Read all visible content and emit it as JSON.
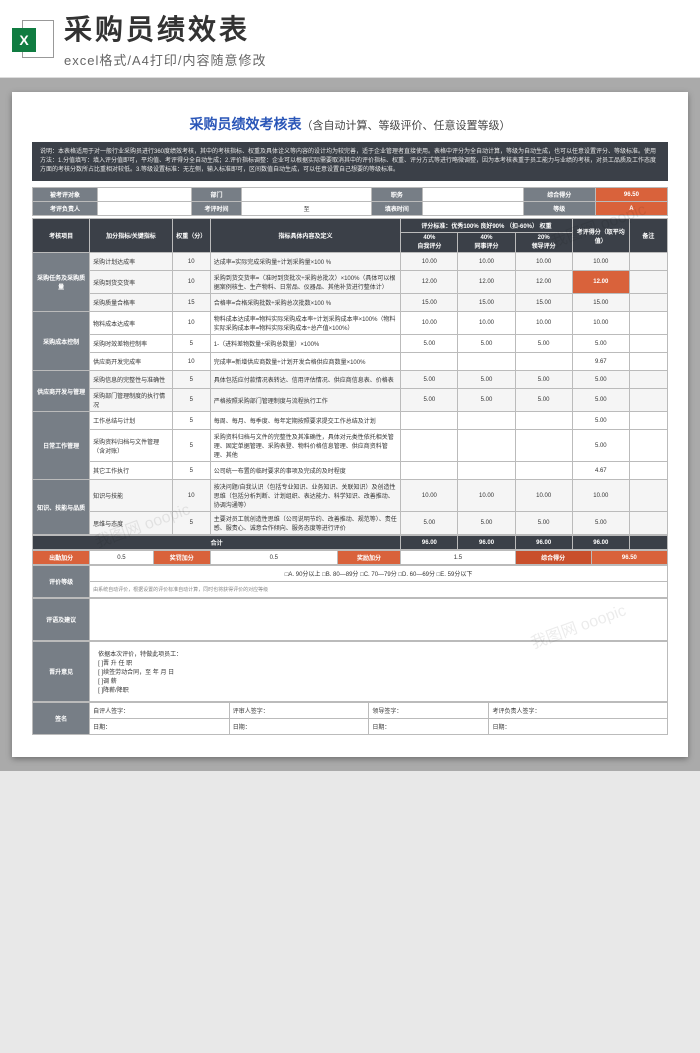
{
  "header": {
    "icon_letter": "X",
    "title": "采购员绩效表",
    "subtitle": "excel格式/A4打印/内容随意修改"
  },
  "doc": {
    "title_main": "采购员绩效考核表",
    "title_sub": "（含自动计算、等级评价、任意设置等级）"
  },
  "instructions": "说明：本表格适用于对一般行业采购员进行360度绩效考核，其中的考核指标、权重及具体诠义等内容的设计均为较完善，适于企业管理者直接使用。表格中评分为全自动计算，等级为自动生成，也可以任意设置评分、等级标准。使用方法：1.分值填写：填入评分值即可，平均值、考评得分全自动生成；2.评价指标调整：企业可以根据实际需要取消其中的评价指标、权重、评分方式等进行略微调整，因为本考核表重于员工能力与业绩的考核，对员工品质及工作态度方面的考核分数所占比重相对较低。3.等级设置标准：无左侧，输入标准即可，区间数值自动生成，可以任意设置自己想要的等级标准。",
  "meta": {
    "l1": "被考评对象",
    "dept": "部门",
    "pos": "职务",
    "total_lbl": "综合得分",
    "total_val": "96.50",
    "l2": "考评负责人",
    "time": "考评时间",
    "to": "至",
    "fill": "填表时间",
    "grade_lbl": "等级",
    "grade_val": "A"
  },
  "head": {
    "c1": "考核项目",
    "c2": "加分指标/关键指标",
    "c3": "权重（分）",
    "c4": "指标具体内容及定义",
    "c5": "评分标准：优秀100%  良好90% （扣-60%） 权重",
    "c5a": "40%",
    "c5b": "40%",
    "c5c": "20%",
    "c6": "考评得分（取平均值）",
    "c7": "备注",
    "r1": "自我评分",
    "r2": "同事评分",
    "r3": "领导评分"
  },
  "groups": [
    {
      "name": "采购任务及采购质量",
      "rows": [
        {
          "k": "采购计划达成率",
          "w": "10",
          "d": "达成率=实际完成采购量÷计划采购量×100 %",
          "a": "10.00",
          "b": "10.00",
          "c": "10.00",
          "s": "10.00",
          "hl": false
        },
        {
          "k": "采购到货交货率",
          "w": "10",
          "d": "采购到货交货率=（准时到货批次÷采购总批次）×100%（具体可以根据案例核生、生产物料、日常品、仪器品、其他补货进行整体计）",
          "a": "12.00",
          "b": "12.00",
          "c": "12.00",
          "s": "12.00",
          "hl": true
        },
        {
          "k": "采购质量合格率",
          "w": "15",
          "d": "合格率=合格采购批数÷采购总次批数×100 %",
          "a": "15.00",
          "b": "15.00",
          "c": "15.00",
          "s": "15.00",
          "hl": false
        }
      ]
    },
    {
      "name": "采购成本控制",
      "rows": [
        {
          "k": "物料成本达成率",
          "w": "10",
          "d": "物料成本达成率=物料实际采购成本率÷计划采购成本率×100%（物料实际采购成本率=物料实际采购成本÷总产值×100%）",
          "a": "10.00",
          "b": "10.00",
          "c": "10.00",
          "s": "10.00",
          "hl": false
        },
        {
          "k": "采购时效差物控制率",
          "w": "5",
          "d": "1-（进料差物数量÷采购总数量）×100%",
          "a": "5.00",
          "b": "5.00",
          "c": "5.00",
          "s": "5.00",
          "hl": false
        },
        {
          "k": "供应商开发完成率",
          "w": "10",
          "d": "完成率=新增供应商数量÷计划开发合格供应商数量×100%",
          "a": "",
          "b": "",
          "c": "",
          "s": "9.67",
          "hl": false
        }
      ]
    },
    {
      "name": "供应商开发与管理",
      "rows": [
        {
          "k": "采购信息的完整性与准确性",
          "w": "5",
          "d": "具体包括应付款情况表转达、信用评估情况、供应商信息表、价格表",
          "a": "5.00",
          "b": "5.00",
          "c": "5.00",
          "s": "5.00",
          "hl": false
        },
        {
          "k": "采购部门管理制度的执行情况",
          "w": "5",
          "d": "严格按照采购部门管理制度与流程执行工作",
          "a": "5.00",
          "b": "5.00",
          "c": "5.00",
          "s": "5.00",
          "hl": false
        }
      ]
    },
    {
      "name": "日常工作管理",
      "rows": [
        {
          "k": "工作总结与计划",
          "w": "5",
          "d": "每周、每月、每季度、每年定期按照要求提交工作总结及计划",
          "a": "",
          "b": "",
          "c": "",
          "s": "5.00",
          "hl": false
        },
        {
          "k": "采购资料归档与文件管理（含对账）",
          "w": "5",
          "d": "采购资料归档与文件的完整性及其准确性，具体对元类性依托相关管理、固定单据管理、采购表登、物料价格信息管理、供应商资料管理、其他",
          "a": "",
          "b": "",
          "c": "",
          "s": "5.00",
          "hl": false
        },
        {
          "k": "其它工作执行",
          "w": "5",
          "d": "公司统一布置的临时要求的事项及完成的及时程度",
          "a": "",
          "b": "",
          "c": "",
          "s": "4.67",
          "hl": false
        }
      ]
    },
    {
      "name": "知识、技能与品质",
      "rows": [
        {
          "k": "知识与技能",
          "w": "10",
          "d": "按决问题/自我认识（包括专业知识、业务知识、关联知识）及创造性思维（包括分析判断、计划组织、表达能力、科学知识、改善推动、协调沟通等）",
          "a": "10.00",
          "b": "10.00",
          "c": "10.00",
          "s": "10.00",
          "hl": false
        },
        {
          "k": "思维与态度",
          "w": "5",
          "d": "主要对员工就创造性思维（公司说明节约、改善推动、规范等）、责任感、服责心、诚意合作倾向、服务态度等进行评价",
          "a": "5.00",
          "b": "5.00",
          "c": "5.00",
          "s": "5.00",
          "hl": false
        }
      ]
    }
  ],
  "sum": {
    "lbl": "合计",
    "a": "96.00",
    "b": "96.00",
    "c": "96.00",
    "s": "96.00"
  },
  "bonus": {
    "l1": "出勤加分",
    "v1": "0.5",
    "l2": "奖罚加分",
    "v2": "0.5",
    "l3": "奖励加分",
    "v3": "1.5",
    "l4": "综合得分",
    "v4": "96.50"
  },
  "grade": {
    "lbl": "评价等级",
    "opts": "□A. 90分以上     □B. 80—89分     □C. 70—79分     □D. 60—69分     □E. 59分以下",
    "note": "由系统自动评价，根据设置的评价标准自动计算，同时也将获得评价的对应等级"
  },
  "comment_lbl": "评语及建议",
  "promo": {
    "lbl": "晋升意见",
    "body": "依据本次评价，特做此项员工：\n[ ]晋  升     任      职\n[ ]续签劳动合同，至   年   月   日\n[ ]调    薪\n[ ]降薪/降职"
  },
  "sign": {
    "lbl": "签名",
    "r1": [
      "自评人签字：",
      "评审人签字：",
      "领导签字：",
      "考评负责人签字："
    ],
    "r2": [
      "日期：",
      "日期：",
      "日期：",
      "日期："
    ]
  },
  "watermark": "我图网 ooopic"
}
